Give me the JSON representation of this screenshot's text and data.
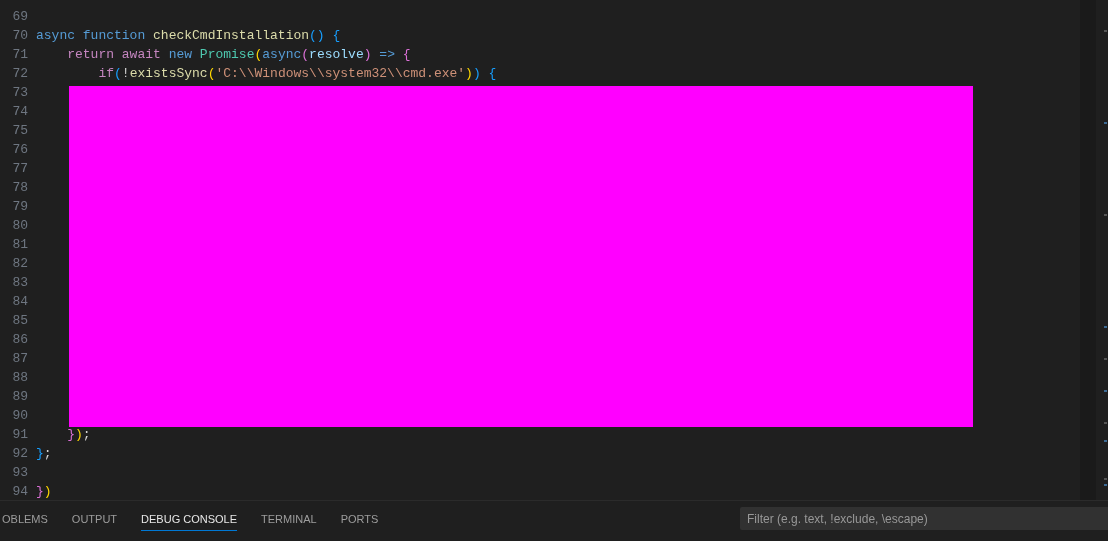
{
  "editor": {
    "lines": [
      {
        "number": "69"
      },
      {
        "number": "70",
        "tokens": [
          {
            "text": "async",
            "kind": "keyword"
          },
          {
            "text": " function",
            "kind": "keyword"
          },
          {
            "text": " checkCmdInstallation",
            "kind": "function"
          },
          {
            "text": "() {",
            "kind": "bracket3"
          }
        ]
      },
      {
        "number": "71",
        "tokens": [
          {
            "text": "    return",
            "kind": "control"
          },
          {
            "text": " await",
            "kind": "control"
          },
          {
            "text": " new",
            "kind": "keyword"
          },
          {
            "text": " Promise",
            "kind": "class"
          },
          {
            "text": "(",
            "kind": "bracket1"
          },
          {
            "text": "async",
            "kind": "keyword"
          },
          {
            "text": "(",
            "kind": "bracket2"
          },
          {
            "text": "resolve",
            "kind": "param"
          },
          {
            "text": ")",
            "kind": "bracket2"
          },
          {
            "text": " =>",
            "kind": "keyword"
          },
          {
            "text": " {",
            "kind": "bracket2"
          }
        ]
      },
      {
        "number": "72",
        "tokens": [
          {
            "text": "        if",
            "kind": "control"
          },
          {
            "text": "(",
            "kind": "bracket3"
          },
          {
            "text": "!",
            "kind": "punct"
          },
          {
            "text": "existsSync",
            "kind": "function"
          },
          {
            "text": "(",
            "kind": "bracket1"
          },
          {
            "text": "'C:\\\\Windows\\\\system32\\\\cmd.exe'",
            "kind": "string"
          },
          {
            "text": ")",
            "kind": "bracket1"
          },
          {
            "text": ") {",
            "kind": "bracket3"
          }
        ]
      },
      {
        "number": "73"
      },
      {
        "number": "74"
      },
      {
        "number": "75"
      },
      {
        "number": "76"
      },
      {
        "number": "77"
      },
      {
        "number": "78"
      },
      {
        "number": "79"
      },
      {
        "number": "80"
      },
      {
        "number": "81"
      },
      {
        "number": "82"
      },
      {
        "number": "83"
      },
      {
        "number": "84"
      },
      {
        "number": "85"
      },
      {
        "number": "86"
      },
      {
        "number": "87"
      },
      {
        "number": "88"
      },
      {
        "number": "89"
      },
      {
        "number": "90"
      },
      {
        "number": "91",
        "tokens": [
          {
            "text": "    }",
            "kind": "bracket2"
          },
          {
            "text": ")",
            "kind": "bracket1"
          },
          {
            "text": ";",
            "kind": "punct"
          }
        ]
      },
      {
        "number": "92",
        "tokens": [
          {
            "text": "}",
            "kind": "bracket3"
          },
          {
            "text": ";",
            "kind": "punct"
          }
        ]
      },
      {
        "number": "93"
      },
      {
        "number": "94",
        "tokens": [
          {
            "text": "}",
            "kind": "bracket2"
          },
          {
            "text": ")",
            "kind": "bracket1"
          }
        ]
      }
    ]
  },
  "panel": {
    "tabs": [
      {
        "label": "OBLEMS",
        "selected": false
      },
      {
        "label": "OUTPUT",
        "selected": false
      },
      {
        "label": "DEBUG CONSOLE",
        "selected": true
      },
      {
        "label": "TERMINAL",
        "selected": false
      },
      {
        "label": "PORTS",
        "selected": false
      }
    ],
    "filter": {
      "placeholder": "Filter (e.g. text, !exclude, \\escape)"
    }
  }
}
